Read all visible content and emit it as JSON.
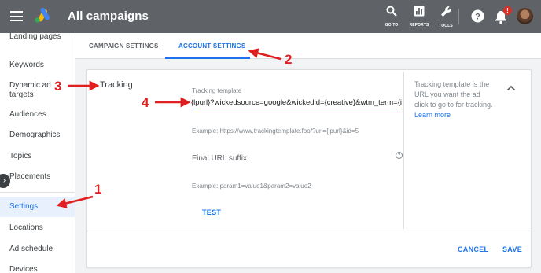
{
  "header": {
    "title": "All campaigns",
    "tools": [
      {
        "label": "GO TO",
        "icon": "search-icon"
      },
      {
        "label": "REPORTS",
        "icon": "reports-icon"
      },
      {
        "label": "TOOLS",
        "icon": "wrench-icon"
      }
    ],
    "notification_badge": "!"
  },
  "sidebar": {
    "items": [
      {
        "label": "Landing pages"
      },
      {
        "label": "Keywords"
      },
      {
        "label": "Dynamic ad targets"
      },
      {
        "label": "Audiences"
      },
      {
        "label": "Demographics"
      },
      {
        "label": "Topics"
      },
      {
        "label": "Placements"
      },
      {
        "label": "Settings",
        "active": true
      },
      {
        "label": "Locations"
      },
      {
        "label": "Ad schedule"
      },
      {
        "label": "Devices"
      }
    ]
  },
  "tabs": [
    {
      "label": "CAMPAIGN SETTINGS",
      "active": false
    },
    {
      "label": "ACCOUNT SETTINGS",
      "active": true
    }
  ],
  "tracking": {
    "section_title": "Tracking",
    "template_label": "Tracking template",
    "template_value": "{lpurl}?wickedsource=google&wickedid={creative}&wtm_term={ifsearch:{keyword}}",
    "template_example": "Example: https://www.trackingtemplate.foo/?url={lpurl}&id=5",
    "suffix_label": "Final URL suffix",
    "suffix_example": "Example: param1=value1&param2=value2",
    "test_button": "TEST",
    "help_text": "Tracking template is the URL you want the ad click to go to for tracking.",
    "learn_more": "Learn more"
  },
  "footer": {
    "cancel": "CANCEL",
    "save": "SAVE"
  },
  "annotations": [
    "1",
    "2",
    "3",
    "4"
  ],
  "colors": {
    "topbar": "#5f6368",
    "accent": "#1a73e8",
    "annotation": "#e02020"
  }
}
